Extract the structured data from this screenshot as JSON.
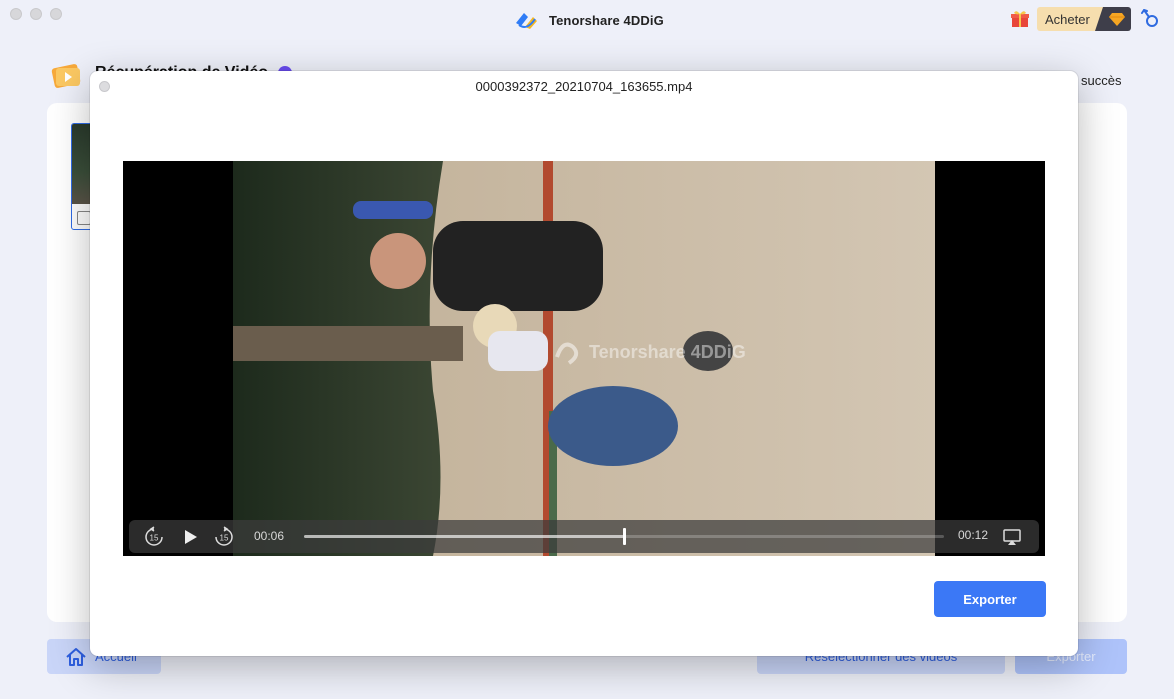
{
  "app": {
    "title": "Tenorshare 4DDiG",
    "buy_label": "Acheter",
    "section_title": "Récupération de Vidéo",
    "success_text": "succès"
  },
  "footer": {
    "home_label": "Accueil",
    "reselect_label": "Resélectionner des vidéos",
    "export_label": "Exporter"
  },
  "modal": {
    "filename": "0000392372_20210704_163655.mp4",
    "watermark": "Tenorshare 4DDiG",
    "export_label": "Exporter"
  },
  "player": {
    "current_time": "00:06",
    "total_time": "00:12",
    "progress": 0.5,
    "rewind_seconds": "15",
    "forward_seconds": "15"
  },
  "colors": {
    "accent": "#3b78f6",
    "buy_bg": "#f6deae",
    "badge": "#6a4df2"
  }
}
